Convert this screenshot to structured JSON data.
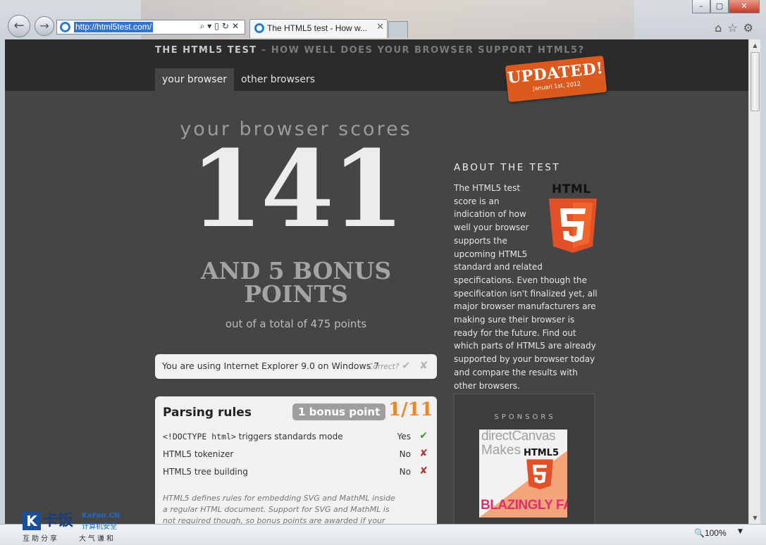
{
  "browser": {
    "url": "http://html5test.com/",
    "tab_title": "The HTML5 test - How w...",
    "zoom": "100%"
  },
  "header": {
    "title_strong": "THE HTML5 TEST",
    "title_rest": " – HOW WELL DOES YOUR BROWSER SUPPORT HTML5?",
    "tabs": [
      {
        "label": "your browser"
      },
      {
        "label": "other browsers"
      }
    ],
    "badge_title": "UPDATED!",
    "badge_date": "Januari 1st, 2012"
  },
  "score": {
    "heading": "your browser scores",
    "value": "141",
    "bonus_line1": "AND 5 BONUS",
    "bonus_line2": "POINTS",
    "total": "out of a total of 475 points"
  },
  "detect": {
    "text": "You are using Internet Explorer 9.0 on Windows 7",
    "correct_label": "Correct?"
  },
  "parsing": {
    "title": "Parsing rules",
    "bonus": "1 bonus point",
    "score": "1/11",
    "rows": [
      {
        "code": "<!DOCTYPE html>",
        "label": " triggers standards mode",
        "result": "Yes"
      },
      {
        "code": "",
        "label": "HTML5 tokenizer",
        "result": "No"
      },
      {
        "code": "",
        "label": "HTML5 tree building",
        "result": "No"
      }
    ],
    "note": "HTML5 defines rules for embedding SVG and MathML inside a regular HTML document. Support for SVG and MathML is not required though, so bonus points are awarded if your browser"
  },
  "about": {
    "title": "ABOUT THE TEST",
    "logo_word": "HTML",
    "text": "The HTML5 test score is an indication of how well your browser supports the upcoming HTML5 standard and related specifications. Even though the specification isn't finalized yet, all major browser manufacturers are making sure their browser is ready for the future. Find out which parts of HTML5 are already supported by your browser today and compare the results with other browsers."
  },
  "sponsors": {
    "title": "SPONSORS",
    "ad_line1": "directCanvas",
    "ad_line2": "Makes",
    "ad_html5": "HTML5",
    "ad_fast": "BLAZINGLY FAST"
  },
  "watermark": {
    "k": "K",
    "brand": "卡饭",
    "domain": "KaFan.CN",
    "domain_sub": "计算机安全",
    "sub1": "互助分享",
    "sub2": "大气谦和"
  },
  "colors": {
    "accent_orange": "#dd5a1f",
    "score_orange": "#e8862a",
    "yes_green": "#3d9a2b",
    "no_red": "#b33a3a"
  }
}
